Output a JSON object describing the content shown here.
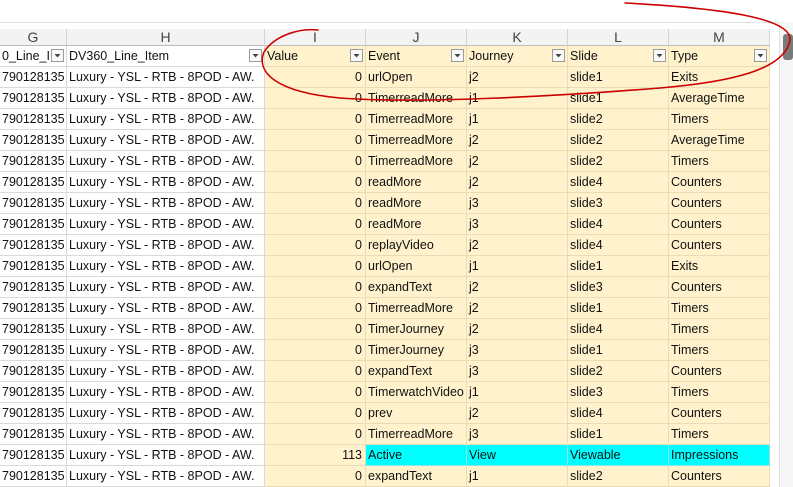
{
  "colors": {
    "highlight_fill": "#fff2cc",
    "selected_row_fill": "#00ffff",
    "annotation_stroke": "#cc0000"
  },
  "column_letters": [
    "G",
    "H",
    "I",
    "J",
    "K",
    "L",
    "M"
  ],
  "headers": [
    "0_Line_I",
    "DV360_Line_Item",
    "Value",
    "Event",
    "Journey",
    "Slide",
    "Type"
  ],
  "rows": [
    [
      "790128135",
      "Luxury - YSL - RTB - 8POD - AW.",
      "0",
      "urlOpen",
      "j2",
      "slide1",
      "Exits"
    ],
    [
      "790128135",
      "Luxury - YSL - RTB - 8POD - AW.",
      "0",
      "TimerreadMore",
      "j1",
      "slide1",
      "AverageTime"
    ],
    [
      "790128135",
      "Luxury - YSL - RTB - 8POD - AW.",
      "0",
      "TimerreadMore",
      "j1",
      "slide2",
      "Timers"
    ],
    [
      "790128135",
      "Luxury - YSL - RTB - 8POD - AW.",
      "0",
      "TimerreadMore",
      "j2",
      "slide2",
      "AverageTime"
    ],
    [
      "790128135",
      "Luxury - YSL - RTB - 8POD - AW.",
      "0",
      "TimerreadMore",
      "j2",
      "slide2",
      "Timers"
    ],
    [
      "790128135",
      "Luxury - YSL - RTB - 8POD - AW.",
      "0",
      "readMore",
      "j2",
      "slide4",
      "Counters"
    ],
    [
      "790128135",
      "Luxury - YSL - RTB - 8POD - AW.",
      "0",
      "readMore",
      "j3",
      "slide3",
      "Counters"
    ],
    [
      "790128135",
      "Luxury - YSL - RTB - 8POD - AW.",
      "0",
      "readMore",
      "j3",
      "slide4",
      "Counters"
    ],
    [
      "790128135",
      "Luxury - YSL - RTB - 8POD - AW.",
      "0",
      "replayVideo",
      "j2",
      "slide4",
      "Counters"
    ],
    [
      "790128135",
      "Luxury - YSL - RTB - 8POD - AW.",
      "0",
      "urlOpen",
      "j1",
      "slide1",
      "Exits"
    ],
    [
      "790128135",
      "Luxury - YSL - RTB - 8POD - AW.",
      "0",
      "expandText",
      "j2",
      "slide3",
      "Counters"
    ],
    [
      "790128135",
      "Luxury - YSL - RTB - 8POD - AW.",
      "0",
      "TimerreadMore",
      "j2",
      "slide1",
      "Timers"
    ],
    [
      "790128135",
      "Luxury - YSL - RTB - 8POD - AW.",
      "0",
      "TimerJourney",
      "j2",
      "slide4",
      "Timers"
    ],
    [
      "790128135",
      "Luxury - YSL - RTB - 8POD - AW.",
      "0",
      "TimerJourney",
      "j3",
      "slide1",
      "Timers"
    ],
    [
      "790128135",
      "Luxury - YSL - RTB - 8POD - AW.",
      "0",
      "expandText",
      "j3",
      "slide2",
      "Counters"
    ],
    [
      "790128135",
      "Luxury - YSL - RTB - 8POD - AW.",
      "0",
      "TimerwatchVideo",
      "j1",
      "slide3",
      "Timers"
    ],
    [
      "790128135",
      "Luxury - YSL - RTB - 8POD - AW.",
      "0",
      "prev",
      "j2",
      "slide4",
      "Counters"
    ],
    [
      "790128135",
      "Luxury - YSL - RTB - 8POD - AW.",
      "0",
      "TimerreadMore",
      "j3",
      "slide1",
      "Timers"
    ],
    [
      "790128135",
      "Luxury - YSL - RTB - 8POD - AW.",
      "113",
      "Active",
      "View",
      "Viewable",
      "Impressions"
    ],
    [
      "790128135",
      "Luxury - YSL - RTB - 8POD - AW.",
      "0",
      "expandText",
      "j1",
      "slide2",
      "Counters"
    ]
  ],
  "highlighted_row_index": 18
}
